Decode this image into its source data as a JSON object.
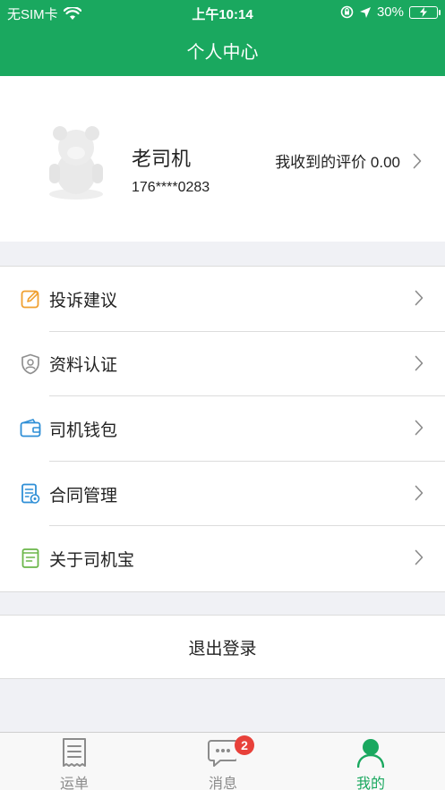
{
  "status_bar": {
    "carrier": "无SIM卡",
    "time": "上午10:14",
    "battery": "30%"
  },
  "header": {
    "title": "个人中心"
  },
  "profile": {
    "name": "老司机",
    "phone": "176****0283",
    "rating_label": "我收到的评价 0.00"
  },
  "menu": {
    "items": [
      {
        "label": "投诉建议",
        "icon": "edit-icon"
      },
      {
        "label": "资料认证",
        "icon": "shield-user-icon"
      },
      {
        "label": "司机钱包",
        "icon": "wallet-icon"
      },
      {
        "label": "合同管理",
        "icon": "contract-icon"
      },
      {
        "label": "关于司机宝",
        "icon": "book-icon"
      }
    ]
  },
  "logout_label": "退出登录",
  "tabbar": {
    "tabs": [
      {
        "label": "运单",
        "icon": "waybill-icon"
      },
      {
        "label": "消息",
        "icon": "message-icon",
        "badge": "2"
      },
      {
        "label": "我的",
        "icon": "person-icon"
      }
    ],
    "active_index": 2
  },
  "colors": {
    "brand_green": "#1aa85f",
    "badge_red": "#e8413a",
    "icon_orange": "#f0a030",
    "icon_blue": "#2f8fd6",
    "icon_grey": "#8f8f8f",
    "icon_green": "#6bb64a"
  }
}
